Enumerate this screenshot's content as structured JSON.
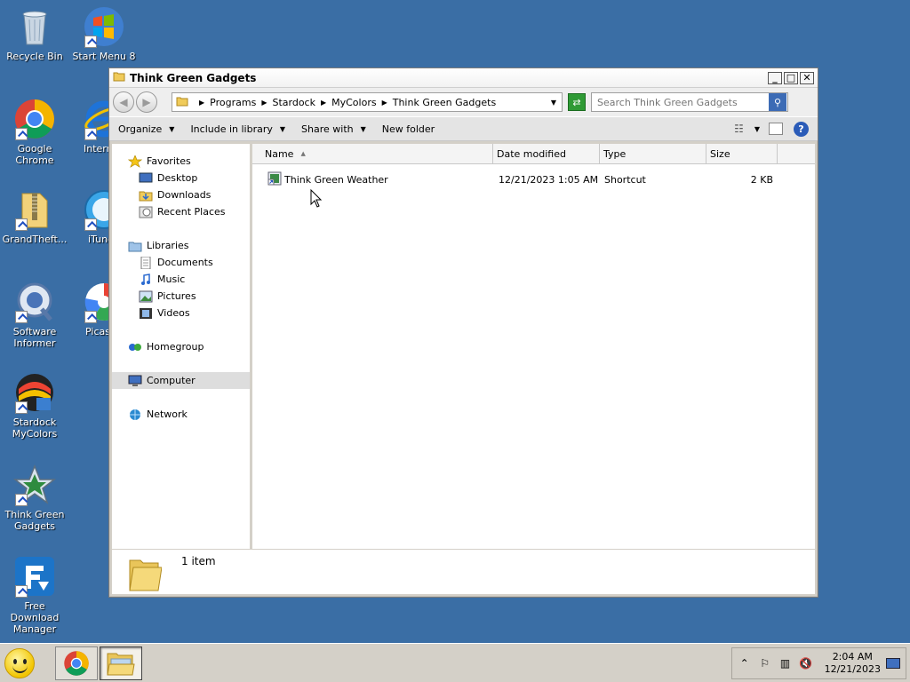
{
  "desktop": {
    "icons": [
      {
        "label": "Recycle Bin"
      },
      {
        "label": "Start Menu 8"
      },
      {
        "label": "Google Chrome"
      },
      {
        "label": "Internet Explorer"
      },
      {
        "label": "GrandTheft..."
      },
      {
        "label": "iTunes"
      },
      {
        "label": "Software Informer"
      },
      {
        "label": "Picasa"
      },
      {
        "label": "Stardock MyColors"
      },
      {
        "label": "Think Green Gadgets"
      },
      {
        "label": "Free Download Manager"
      }
    ]
  },
  "window": {
    "title": "Think Green Gadgets",
    "breadcrumb": [
      "Programs",
      "Stardock",
      "MyColors",
      "Think Green Gadgets"
    ],
    "search_placeholder": "Search Think Green Gadgets",
    "toolbar": {
      "organize": "Organize",
      "include_in_library": "Include in library",
      "share_with": "Share with",
      "new_folder": "New folder"
    },
    "nav": {
      "favorites": "Favorites",
      "desktop": "Desktop",
      "downloads": "Downloads",
      "recent_places": "Recent Places",
      "libraries": "Libraries",
      "documents": "Documents",
      "music": "Music",
      "pictures": "Pictures",
      "videos": "Videos",
      "homegroup": "Homegroup",
      "computer": "Computer",
      "network": "Network"
    },
    "columns": {
      "name": "Name",
      "date_modified": "Date modified",
      "type": "Type",
      "size": "Size"
    },
    "files": [
      {
        "name": "Think Green Weather",
        "date_modified": "12/21/2023 1:05 AM",
        "type": "Shortcut",
        "size": "2 KB"
      }
    ],
    "details": {
      "count": "1 item"
    }
  },
  "taskbar": {
    "time": "2:04 AM",
    "date": "12/21/2023"
  }
}
